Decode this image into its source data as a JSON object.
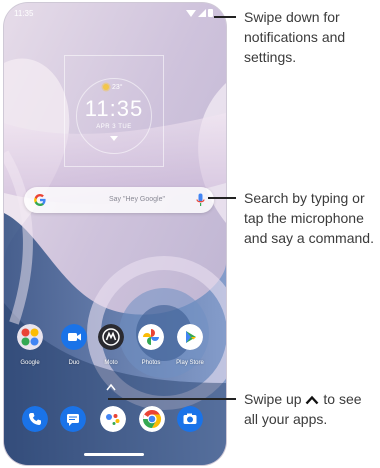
{
  "status_bar": {
    "time": "11:35"
  },
  "clock_widget": {
    "weather": "23°",
    "time": "11:35",
    "date": "APR 3 TUE"
  },
  "search_bar": {
    "placeholder": "Say \"Hey Google\""
  },
  "apps": [
    {
      "label": "Google",
      "icon": "google-folder-icon"
    },
    {
      "label": "Duo",
      "icon": "duo-icon"
    },
    {
      "label": "Moto",
      "icon": "moto-icon"
    },
    {
      "label": "Photos",
      "icon": "photos-icon"
    },
    {
      "label": "Play Store",
      "icon": "play-store-icon"
    }
  ],
  "dock": [
    {
      "icon": "phone-icon"
    },
    {
      "icon": "messages-icon"
    },
    {
      "icon": "assistant-icon"
    },
    {
      "icon": "chrome-icon"
    },
    {
      "icon": "camera-icon"
    }
  ],
  "callouts": {
    "notifications": [
      "Swipe down for",
      "notifications and",
      "settings."
    ],
    "search": [
      "Search by typing or",
      "tap the microphone",
      "and say a command."
    ],
    "apps_line1": "Swipe up",
    "apps_line1b": "to see",
    "apps_line2": "all your apps."
  },
  "colors": {
    "accent": "#1a73e8",
    "wallpaper_blue": "#4a6fa0",
    "wallpaper_lilac": "#cbbfd6"
  }
}
